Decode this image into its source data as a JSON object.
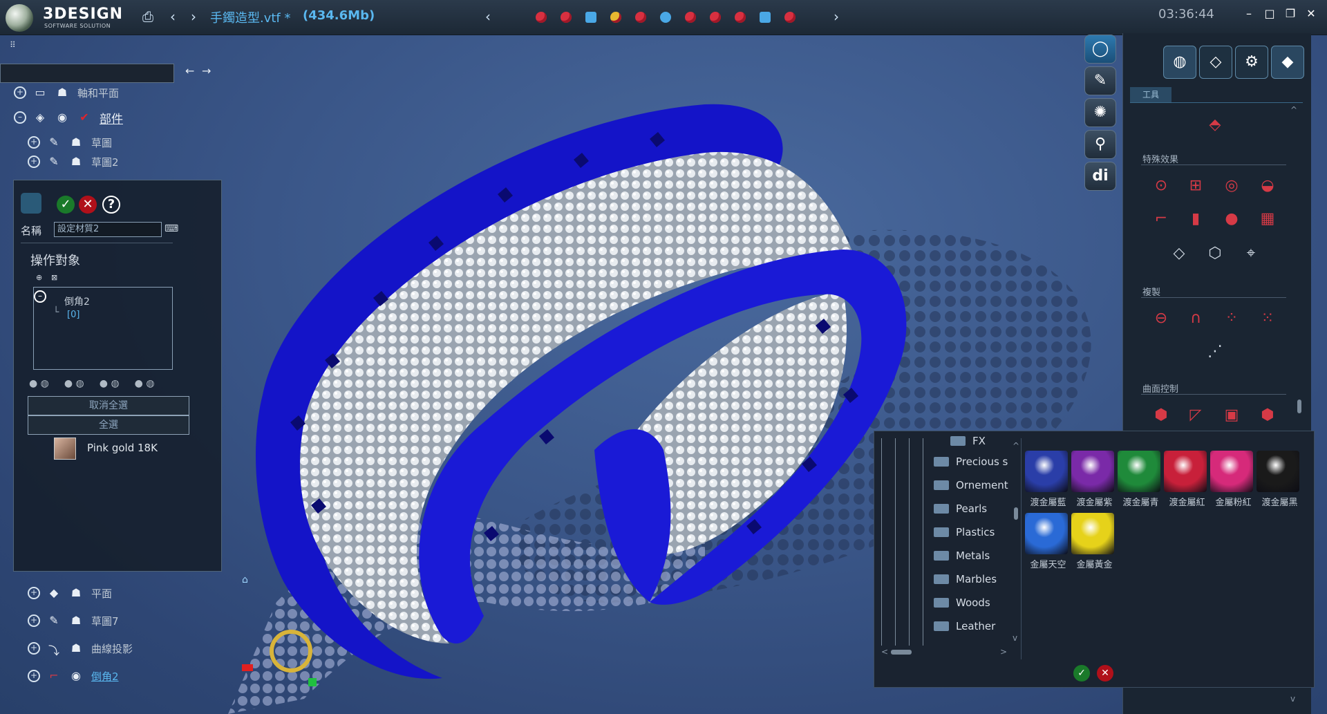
{
  "app": {
    "logo_title": "3DESIGN",
    "logo_subtitle": "SOFTWARE SOLUTION",
    "file_title": "手鐲造型.vtf *",
    "file_size": "(434.6Mb)",
    "clock": "03:36:44"
  },
  "tree": {
    "top_items": [
      {
        "label": "軸和平面",
        "icon": "folder-icon"
      },
      {
        "label": "部件",
        "icon": "part-icon"
      },
      {
        "label": "草圖",
        "icon": "sketch-icon"
      },
      {
        "label": "草圖2",
        "icon": "sketch-icon"
      }
    ],
    "bottom_items": [
      {
        "label": "平面",
        "icon": "plane-icon"
      },
      {
        "label": "草圖7",
        "icon": "sketch-icon"
      },
      {
        "label": "曲線投影",
        "icon": "projection-icon"
      },
      {
        "label": "倒角2",
        "icon": "fillet-icon"
      }
    ]
  },
  "properties": {
    "name_label": "名稱",
    "name_value": "設定材質2",
    "section_title": "操作對象",
    "targets": [
      {
        "label": "倒角2"
      },
      {
        "label": "[0]"
      }
    ],
    "deselect_all": "取消全選",
    "select_all": "全選",
    "material_name": "Pink gold 18K"
  },
  "right_panel": {
    "tab_label": "工具",
    "sections": [
      {
        "title": "特殊效果"
      },
      {
        "title": "複製"
      },
      {
        "title": "曲面控制"
      }
    ]
  },
  "materials": {
    "folders": [
      "FX",
      "Precious s",
      "Ornement",
      "Pearls",
      "Plastics",
      "Metals",
      "Marbles",
      "Woods",
      "Leather"
    ],
    "swatches": [
      {
        "label": "渡金屬藍",
        "color": "#2a3ea8"
      },
      {
        "label": "渡金屬紫",
        "color": "#7a2aa8"
      },
      {
        "label": "渡金屬青",
        "color": "#1f8a3a"
      },
      {
        "label": "渡金屬紅",
        "color": "#c8203a"
      },
      {
        "label": "金屬粉紅",
        "color": "#d62a7a"
      },
      {
        "label": "渡金屬黑",
        "color": "#1a1a1a"
      },
      {
        "label": "金屬天空",
        "color": "#2a6ad6"
      },
      {
        "label": "金屬黃金",
        "color": "#e6d21a"
      }
    ]
  },
  "colors": {
    "bangle": "#1a1ad6",
    "accent": "#5ab8f0",
    "tool_red": "#d63a46"
  }
}
